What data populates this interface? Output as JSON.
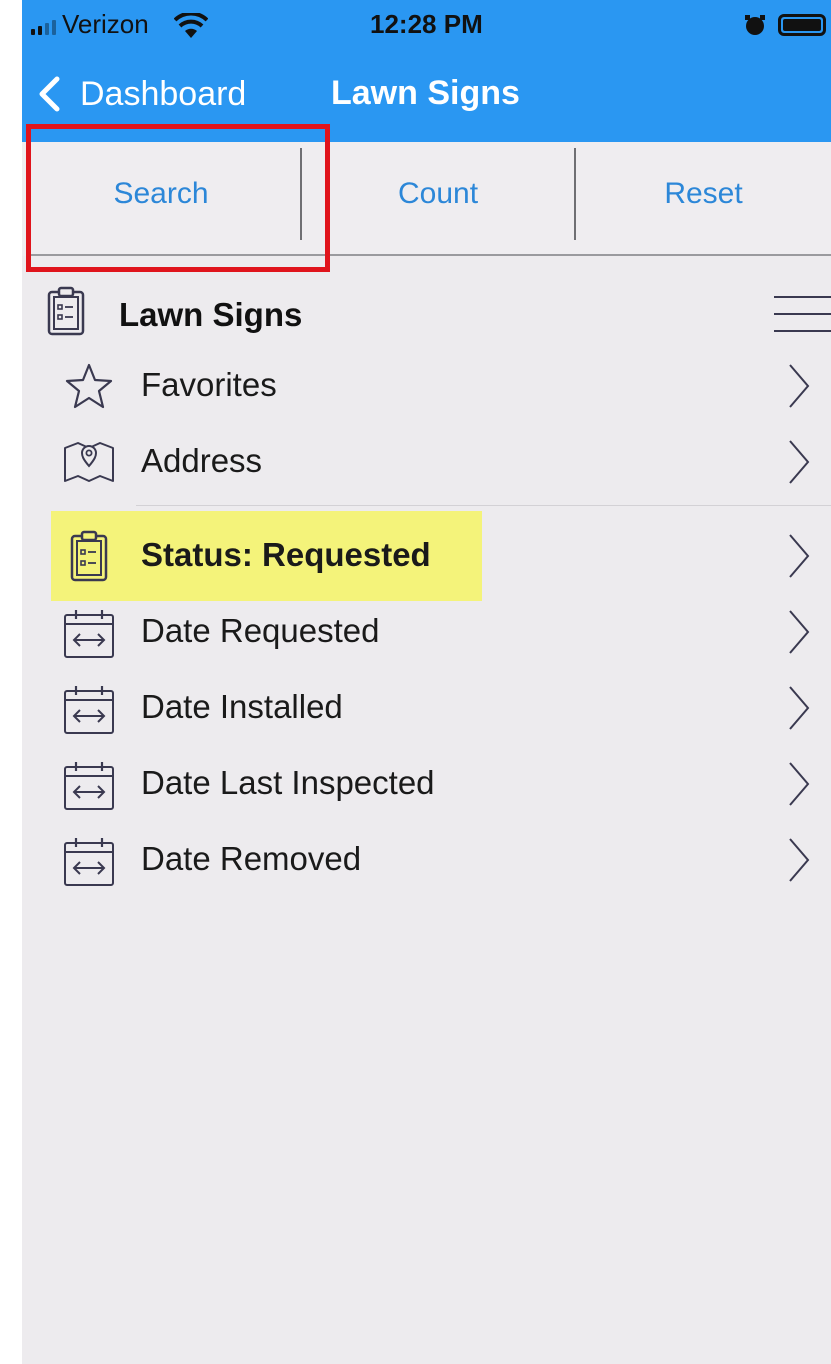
{
  "status_bar": {
    "carrier": "Verizon",
    "time": "12:28 PM"
  },
  "nav": {
    "back_label": "Dashboard",
    "title": "Lawn Signs"
  },
  "toolbar": {
    "search_label": "Search",
    "count_label": "Count",
    "reset_label": "Reset"
  },
  "section": {
    "title": "Lawn Signs"
  },
  "items": [
    {
      "label": "Favorites",
      "icon": "star-icon"
    },
    {
      "label": "Address",
      "icon": "map-pin-icon"
    },
    {
      "label": "Status: Requested",
      "icon": "clipboard-icon",
      "highlighted": true
    },
    {
      "label": "Date Requested",
      "icon": "calendar-range-icon"
    },
    {
      "label": "Date Installed",
      "icon": "calendar-range-icon"
    },
    {
      "label": "Date Last Inspected",
      "icon": "calendar-range-icon"
    },
    {
      "label": "Date Removed",
      "icon": "calendar-range-icon"
    }
  ],
  "colors": {
    "nav_blue": "#2a97f2",
    "link_blue": "#2c87d8",
    "background": "#edebee",
    "highlight_yellow": "#f4f37a",
    "annotation_red": "#e0141c",
    "icon_navy": "#3a3950"
  }
}
